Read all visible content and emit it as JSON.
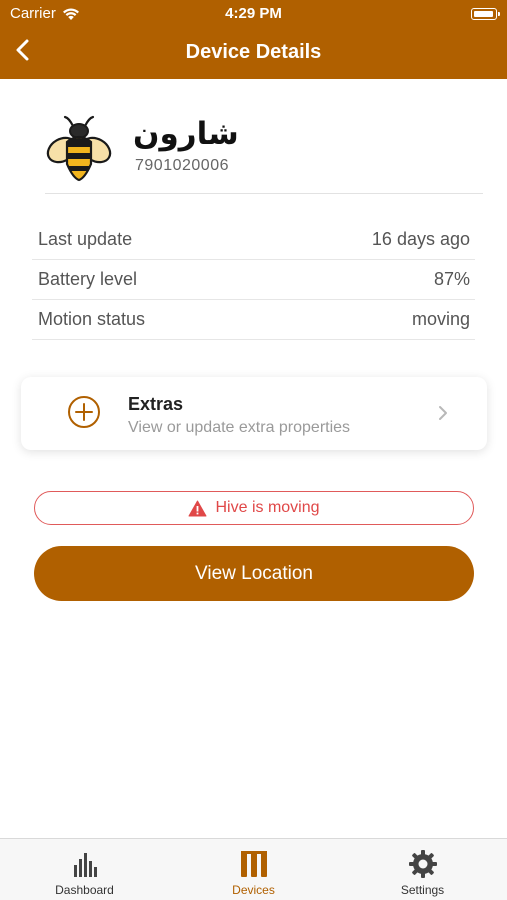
{
  "status_bar": {
    "carrier": "Carrier",
    "time": "4:29 PM"
  },
  "nav": {
    "title": "Device Details"
  },
  "device": {
    "name": "شارون",
    "serial": "7901020006"
  },
  "info": [
    {
      "label": "Last update",
      "value": "16 days ago"
    },
    {
      "label": "Battery level",
      "value": "87%"
    },
    {
      "label": "Motion status",
      "value": "moving"
    }
  ],
  "extras": {
    "title": "Extras",
    "subtitle": "View or update extra properties"
  },
  "alert": {
    "text": "Hive is moving"
  },
  "view_location": {
    "label": "View Location"
  },
  "tabs": [
    {
      "label": "Dashboard",
      "active": false
    },
    {
      "label": "Devices",
      "active": true
    },
    {
      "label": "Settings",
      "active": false
    }
  ],
  "colors": {
    "brand": "#b06000",
    "alert": "#e04848"
  }
}
